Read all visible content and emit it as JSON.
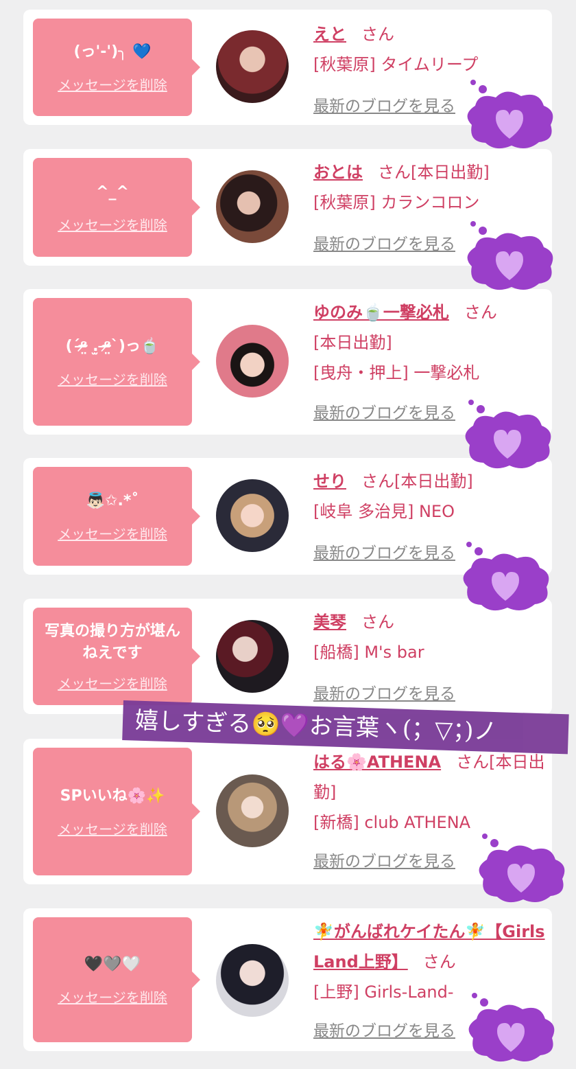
{
  "delete_label": "メッセージを削除",
  "san": "さん",
  "blog_label": "最新のブログを見る",
  "items": [
    {
      "message": "(っ'-')╮ 💙",
      "name": "えと",
      "status": "",
      "shop": "[秋葉原] タイムリープ",
      "avatar_color": "#5b2a2e"
    },
    {
      "message": "^_^",
      "name": "おとは",
      "status": "[本日出勤]",
      "shop": "[秋葉原] カランコロン",
      "avatar_color": "#4a2d2b"
    },
    {
      "message": "(ˊᵒ̴̶̷̤ .̫ ᵒ̴̶̷̤ˋ)っ🍵",
      "name": "ゆのみ🍵一撃必札",
      "status": "[本日出勤]",
      "shop": "[曳舟・押上] 一撃必札",
      "avatar_color": "#d97b8a"
    },
    {
      "message": "👼🏻✩.*˚",
      "name": "せり",
      "status": "[本日出勤]",
      "shop": "[岐阜 多治見] NEO",
      "avatar_color": "#5e5a6a"
    },
    {
      "message": "写真の撮り方が堪んねえです",
      "name": "美琴",
      "status": "",
      "shop": "[船橋] M's bar",
      "avatar_color": "#3a2a30"
    },
    {
      "message": "SPいいね🌸✨",
      "name": "はる🌸ATHENA",
      "status": "[本日出勤]",
      "shop": "[新橋] club ATHENA",
      "avatar_color": "#8a7a6e"
    },
    {
      "message": "🖤🩶🤍",
      "name": "🧚がんばれケイたん🧚【Girls Land上野】",
      "status": "",
      "shop": "[上野] Girls-Land-",
      "avatar_color": "#2b2b3a"
    }
  ],
  "overlay_text": "嬉しすぎる🥺💜お言葉ヽ(；▽；)ノ",
  "colors": {
    "bubble": "#f58d9b",
    "name": "#cf3f63",
    "cloud": "#9a3fc9",
    "banner": "#7a3b97"
  }
}
